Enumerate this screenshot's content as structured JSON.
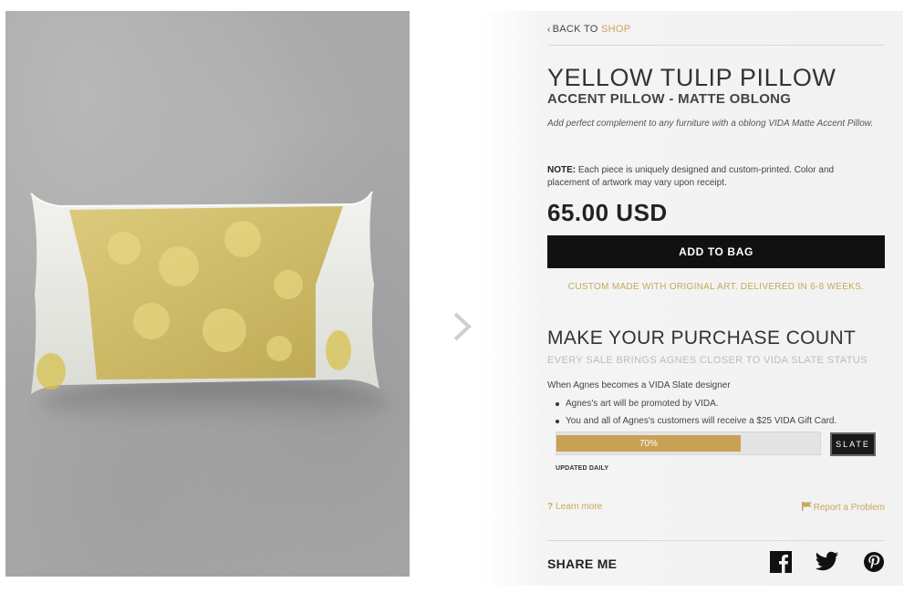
{
  "back_link": {
    "prefix": "BACK TO",
    "shop": "SHOP"
  },
  "product": {
    "title": "YELLOW TULIP PILLOW",
    "subtitle": "ACCENT PILLOW - MATTE OBLONG",
    "description": "Add perfect complement to any furniture with a oblong VIDA Matte Accent Pillow.",
    "note_label": "NOTE:",
    "note_text": "Each piece is uniquely designed and custom-printed. Color and placement of artwork may vary upon receipt.",
    "price": "65.00 USD"
  },
  "add_to_bag": "ADD TO BAG",
  "custom_made": "CUSTOM MADE WITH ORIGINAL ART. DELIVERED IN 6-8 WEEKS.",
  "purchase_count": {
    "heading": "MAKE YOUR PURCHASE COUNT",
    "subheading": "EVERY SALE BRINGS AGNES CLOSER TO VIDA SLATE STATUS",
    "intro": "When Agnes becomes a VIDA Slate designer",
    "bullets": [
      "Agnes's art will be promoted by VIDA.",
      "You and all of Agnes's customers will receive a $25 VIDA Gift Card."
    ],
    "progress_label": "70%",
    "progress_value": 0.7,
    "badge": "SLATE",
    "updated": "UPDATED DAILY"
  },
  "links": {
    "learn_more": "Learn more",
    "report": "Report a Problem"
  },
  "share": {
    "label": "SHARE ME",
    "icons": [
      "facebook-icon",
      "twitter-icon",
      "pinterest-icon"
    ]
  },
  "colors": {
    "accent": "#c9a65d",
    "button": "#111111",
    "progress": "#c8a153"
  }
}
